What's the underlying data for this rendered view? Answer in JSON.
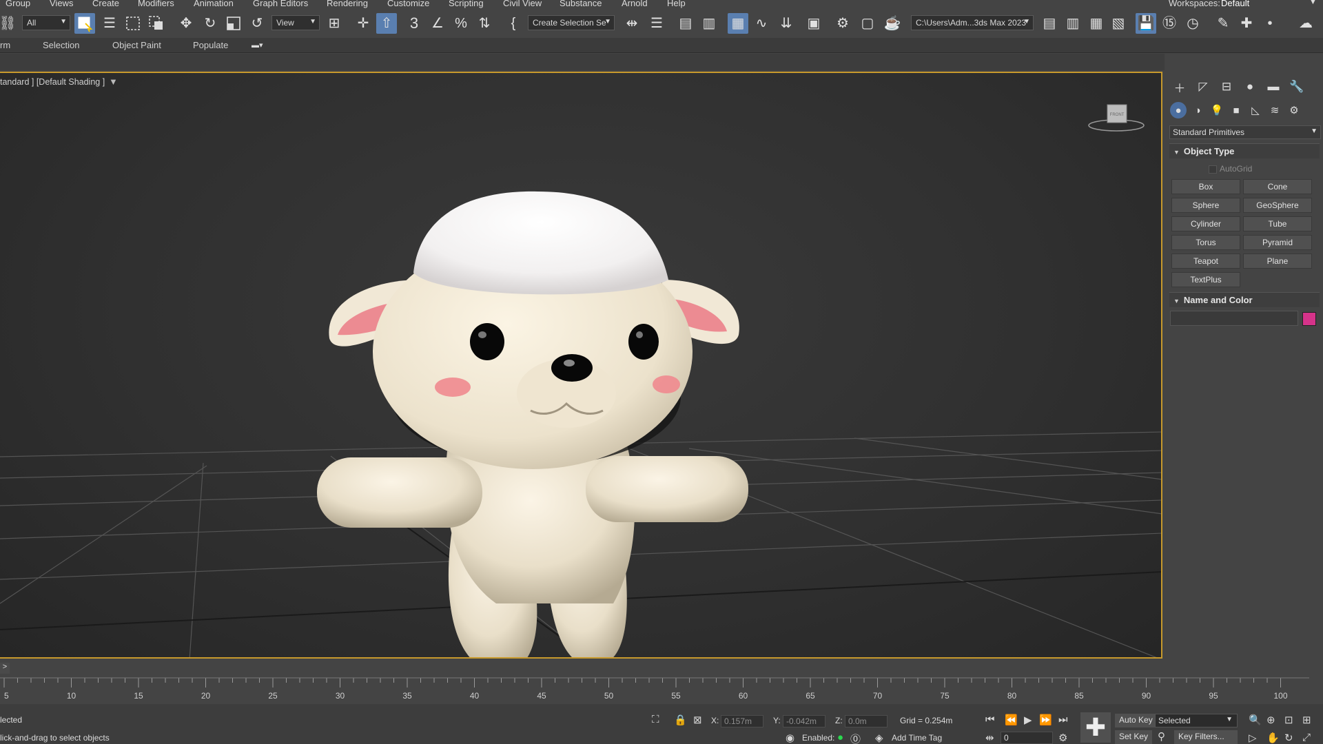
{
  "menu": {
    "items": [
      "Group",
      "Views",
      "Create",
      "Modifiers",
      "Animation",
      "Graph Editors",
      "Rendering",
      "Customize",
      "Scripting",
      "Civil View",
      "Substance",
      "Arnold",
      "Help"
    ],
    "workspace_label": "Workspaces:",
    "workspace_value": "Default"
  },
  "toolbar": {
    "selection_filter": "All",
    "ref_coord": "View",
    "named_selection": "Create Selection Se",
    "project_path": "C:\\Users\\Adm...3ds Max 2023",
    "snap_angle_label": "3"
  },
  "ribbon": {
    "tabs": [
      "rm",
      "Selection",
      "Object Paint",
      "Populate"
    ]
  },
  "viewport": {
    "label": "tandard ] [Default Shading ]",
    "border_color": "#c89a2c",
    "viewcube_label": "FRONT"
  },
  "command_panel": {
    "primitive_type": "Standard Primitives",
    "object_type_title": "Object Type",
    "autogrid": "AutoGrid",
    "buttons": [
      [
        "Box",
        "Cone"
      ],
      [
        "Sphere",
        "GeoSphere"
      ],
      [
        "Cylinder",
        "Tube"
      ],
      [
        "Torus",
        "Pyramid"
      ],
      [
        "Teapot",
        "Plane"
      ],
      [
        "TextPlus",
        ""
      ]
    ],
    "name_color_title": "Name and Color",
    "object_color": "#d6338a"
  },
  "timeline": {
    "expander": ">",
    "start_label": "5",
    "ticks": [
      10,
      15,
      20,
      25,
      30,
      35,
      40,
      45,
      50,
      55,
      60,
      65,
      70,
      75,
      80,
      85,
      90,
      95,
      100
    ]
  },
  "status": {
    "selected_text": "lected",
    "prompt_text": "lick-and-drag to select objects",
    "x_label": "X:",
    "x_value": "0.157m",
    "y_label": "Y:",
    "y_value": "-0.042m",
    "z_label": "Z:",
    "z_value": "0.0m",
    "grid": "Grid = 0.254m",
    "enabled_label": "Enabled:",
    "add_time_tag": "Add Time Tag",
    "auto_key": "Auto Key",
    "set_key": "Set Key",
    "key_mode": "Selected",
    "key_filters": "Key Filters...",
    "frame": "0"
  }
}
